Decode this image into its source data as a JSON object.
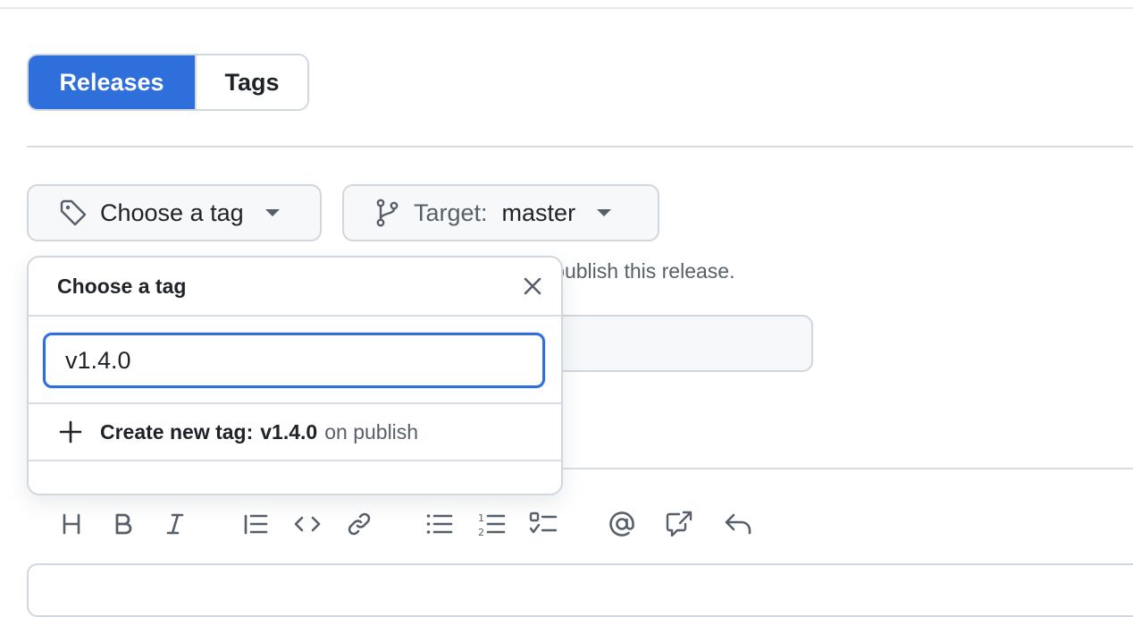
{
  "tabs": {
    "releases": "Releases",
    "tags": "Tags"
  },
  "tag_select": {
    "label": "Choose a tag",
    "icon": "tag-icon"
  },
  "target_select": {
    "label": "Target:",
    "value": "master",
    "icon": "git-branch-icon"
  },
  "helper_text": "u publish this release.",
  "dropdown": {
    "title": "Choose a tag",
    "filter_value": "v1.4.0",
    "create_label": "Create new tag:",
    "create_tag": "v1.4.0",
    "create_suffix": "on publish"
  },
  "toolbar": [
    "heading-icon",
    "bold-icon",
    "italic-icon",
    "quote-icon",
    "code-icon",
    "link-icon",
    "unordered-list-icon",
    "ordered-list-icon",
    "task-list-icon",
    "mention-icon",
    "cross-reference-icon",
    "reply-icon"
  ],
  "colors": {
    "accent": "#2f6fdc",
    "border": "#d0d7de",
    "muted_text": "#57606a",
    "button_bg": "#f6f8fa"
  }
}
